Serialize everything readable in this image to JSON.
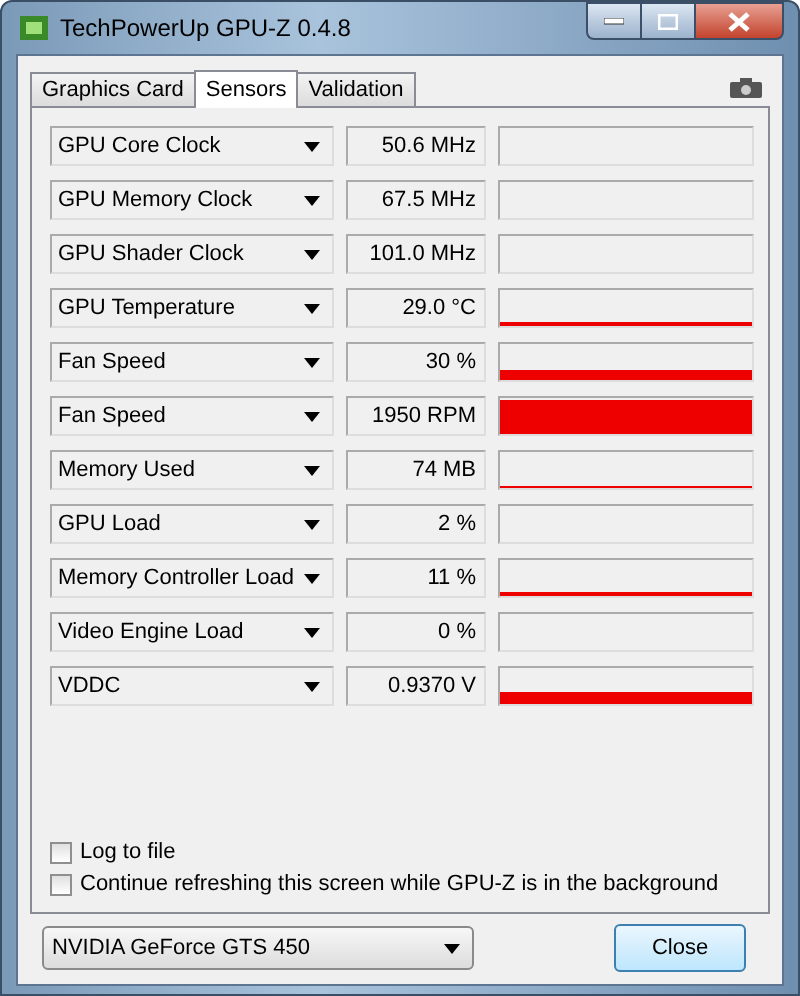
{
  "window": {
    "title": "TechPowerUp GPU-Z 0.4.8"
  },
  "tabs": [
    {
      "label": "Graphics Card",
      "selected": false
    },
    {
      "label": "Sensors",
      "selected": true
    },
    {
      "label": "Validation",
      "selected": false
    }
  ],
  "sensors": [
    {
      "name": "GPU Core Clock",
      "reading": "50.6 MHz"
    },
    {
      "name": "GPU Memory Clock",
      "reading": "67.5 MHz"
    },
    {
      "name": "GPU Shader Clock",
      "reading": "101.0 MHz"
    },
    {
      "name": "GPU Temperature",
      "reading": "29.0 °C"
    },
    {
      "name": "Fan Speed",
      "reading": "30 %"
    },
    {
      "name": "Fan Speed",
      "reading": "1950 RPM"
    },
    {
      "name": "Memory Used",
      "reading": "74 MB"
    },
    {
      "name": "GPU Load",
      "reading": "2 %"
    },
    {
      "name": "Memory Controller Load",
      "reading": "11 %"
    },
    {
      "name": "Video Engine Load",
      "reading": "0 %"
    },
    {
      "name": "VDDC",
      "reading": "0.9370 V"
    }
  ],
  "options": [
    {
      "label": "Log to file",
      "checked": false
    },
    {
      "label": "Continue refreshing this screen while GPU-Z is in the background",
      "checked": false
    }
  ],
  "card_select": {
    "value": "NVIDIA GeForce GTS 450"
  },
  "buttons": [
    "Close"
  ]
}
